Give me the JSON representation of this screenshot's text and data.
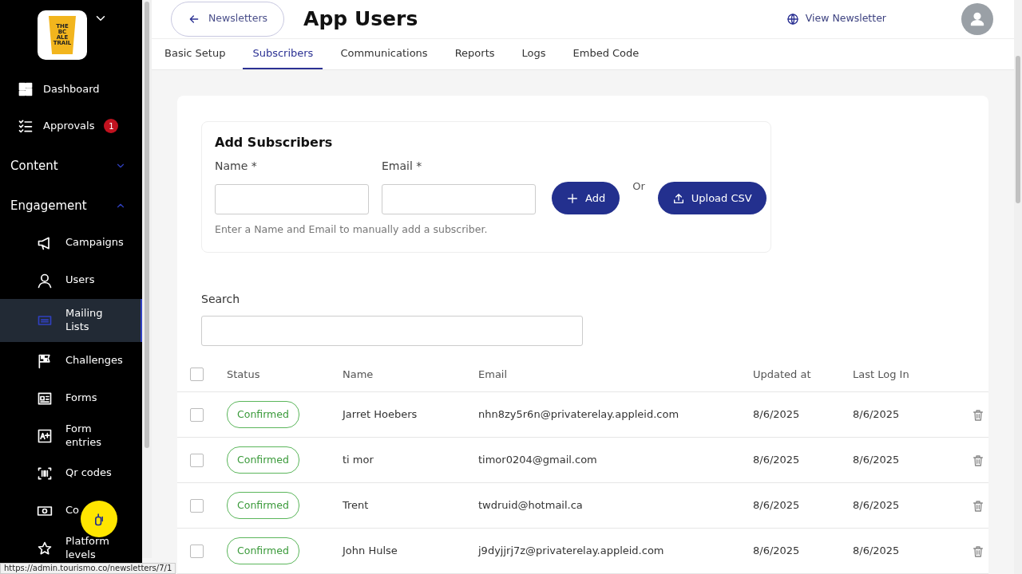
{
  "sidebar": {
    "logo_text": [
      "THE",
      "BC",
      "ALE",
      "TRAIL"
    ],
    "items": [
      {
        "label": "Dashboard",
        "selected": false
      },
      {
        "label": "Approvals",
        "badge": "1",
        "selected": false
      }
    ],
    "sections": [
      {
        "label": "Content",
        "expanded": false
      },
      {
        "label": "Engagement",
        "expanded": true,
        "children": [
          {
            "label": "Campaigns",
            "selected": false
          },
          {
            "label": "Users",
            "selected": false
          },
          {
            "label": "Mailing Lists",
            "selected": true
          },
          {
            "label": "Challenges",
            "selected": false
          },
          {
            "label": "Forms",
            "selected": false
          },
          {
            "label": "Form entries",
            "selected": false
          },
          {
            "label": "Qr codes",
            "selected": false
          },
          {
            "label": "Co",
            "selected": false
          },
          {
            "label": "Platform levels",
            "selected": false
          }
        ]
      }
    ]
  },
  "header": {
    "back_button": "Newsletters",
    "title": "App Users",
    "view_link": "View Newsletter"
  },
  "tabs": [
    {
      "label": "Basic Setup",
      "selected": false
    },
    {
      "label": "Subscribers",
      "selected": true
    },
    {
      "label": "Communications",
      "selected": false
    },
    {
      "label": "Reports",
      "selected": false
    },
    {
      "label": "Logs",
      "selected": false
    },
    {
      "label": "Embed Code",
      "selected": false
    }
  ],
  "add_form": {
    "title": "Add Subscribers",
    "name_label": "Name *",
    "email_label": "Email *",
    "add_button": "Add",
    "or": "Or",
    "upload_button": "Upload CSV",
    "hint": "Enter a Name and Email to manually add a subscriber."
  },
  "search": {
    "label": "Search"
  },
  "table": {
    "select_all_checked": false,
    "columns": [
      "Status",
      "Name",
      "Email",
      "Updated at",
      "Last Log In"
    ],
    "rows": [
      {
        "checked": false,
        "status": "Confirmed",
        "name": "Jarret Hoebers",
        "email": "nhn8zy5r6n@privaterelay.appleid.com",
        "updated": "8/6/2025",
        "last_login": "8/6/2025"
      },
      {
        "checked": false,
        "status": "Confirmed",
        "name": "ti mor",
        "email": "timor0204@gmail.com",
        "updated": "8/6/2025",
        "last_login": "8/6/2025"
      },
      {
        "checked": false,
        "status": "Confirmed",
        "name": "Trent",
        "email": "twdruid@hotmail.ca",
        "updated": "8/6/2025",
        "last_login": "8/6/2025"
      },
      {
        "checked": false,
        "status": "Confirmed",
        "name": "John Hulse",
        "email": "j9dyjjrj7z@privaterelay.appleid.com",
        "updated": "8/6/2025",
        "last_login": "8/6/2025"
      }
    ]
  },
  "status_bar": "https://admin.tourismo.co/newsletters/7/1"
}
